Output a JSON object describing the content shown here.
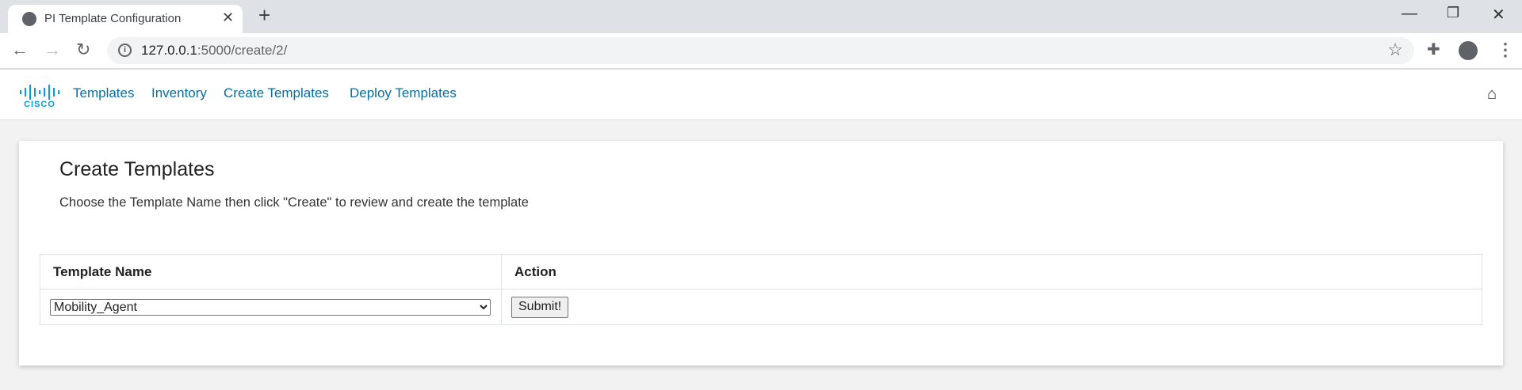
{
  "browser": {
    "tab_title": "PI Template Configuration",
    "url_host": "127.0.0.1",
    "url_path": ":5000/create/2/"
  },
  "nav": {
    "links": [
      "Templates",
      "Inventory",
      "Create Templates",
      "Deploy Templates"
    ],
    "brand": "cisco"
  },
  "page": {
    "title": "Create Templates",
    "instructions": "Choose the Template Name then click \"Create\" to review and create the template"
  },
  "table": {
    "headers": [
      "Template Name",
      "Action"
    ],
    "selected_template": "Mobility_Agent",
    "submit_label": "Submit!"
  },
  "colors": {
    "link": "#0a6e9c",
    "brand": "#049fd9"
  }
}
